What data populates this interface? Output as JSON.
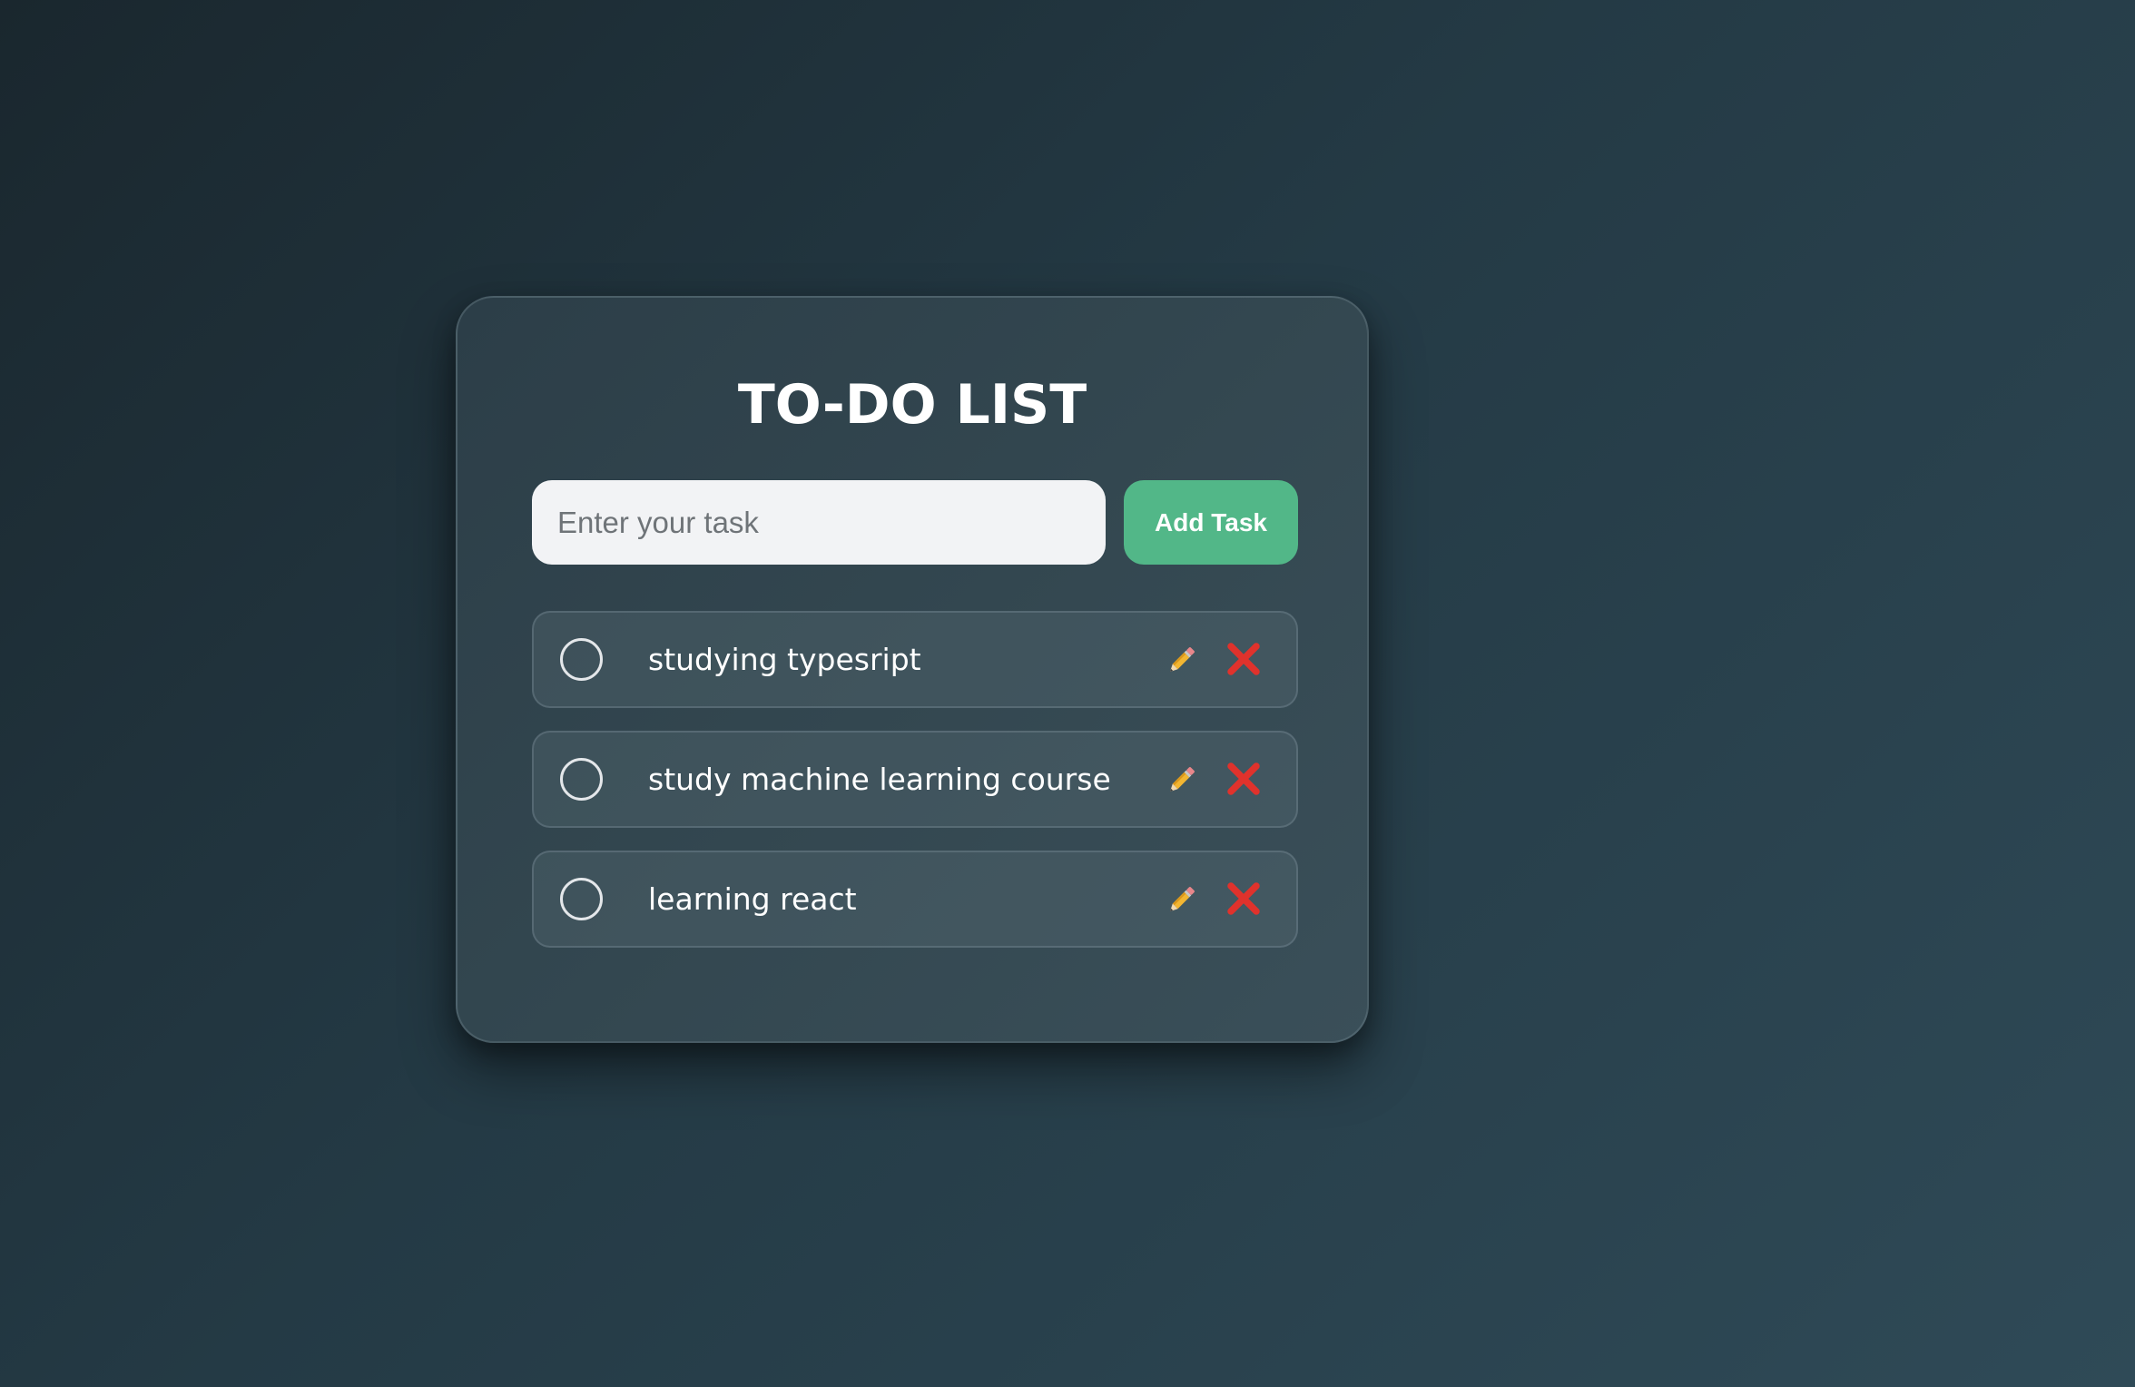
{
  "app": {
    "title": "TO-DO LIST"
  },
  "input": {
    "placeholder": "Enter your task",
    "value": ""
  },
  "add_button": {
    "label": "Add Task"
  },
  "tasks": [
    {
      "text": "studying typesript",
      "completed": false
    },
    {
      "text": "study machine learning course",
      "completed": false
    },
    {
      "text": "learning react",
      "completed": false
    }
  ],
  "icons": {
    "edit": "pencil-icon",
    "delete": "cross-mark-icon",
    "complete": "circle-checkbox-icon"
  },
  "colors": {
    "accent": "#52b788",
    "delete": "#e0322c",
    "pencil": "#f2b632"
  }
}
